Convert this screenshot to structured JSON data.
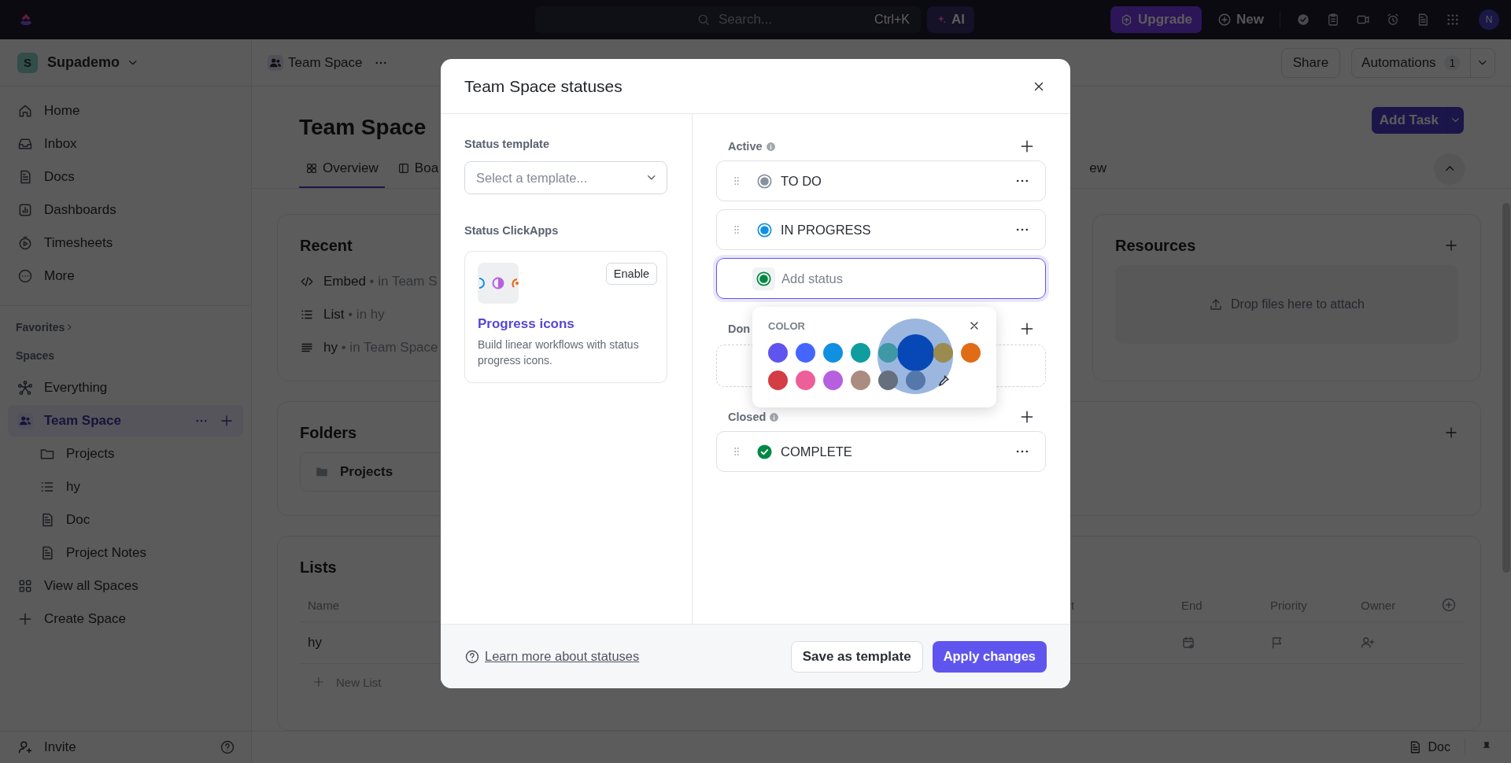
{
  "top_bar": {
    "search": {
      "placeholder": "Search...",
      "shortcut": "Ctrl+K"
    },
    "ai_button": "AI",
    "upgrade_button": "Upgrade",
    "new_button": "New",
    "avatar": "N"
  },
  "sidebar": {
    "workspace": {
      "initial": "S",
      "name": "Supademo"
    },
    "nav": [
      {
        "kind": "home",
        "label": "Home",
        "selected": false
      },
      {
        "kind": "inbox",
        "label": "Inbox",
        "selected": false
      },
      {
        "kind": "doc",
        "label": "Docs",
        "selected": false
      },
      {
        "kind": "dashboard",
        "label": "Dashboards",
        "selected": false
      },
      {
        "kind": "timesheet",
        "label": "Timesheets",
        "selected": false
      },
      {
        "kind": "more",
        "label": "More",
        "selected": false
      }
    ],
    "favorites": "Favorites",
    "spaces_heading": "Spaces",
    "spaces": [
      {
        "kind": "everything",
        "label": "Everything",
        "selected": false
      },
      {
        "kind": "team",
        "label": "Team Space",
        "selected": true,
        "children": [
          {
            "kind": "folder",
            "label": "Projects",
            "selected": false
          },
          {
            "kind": "list",
            "label": "hy",
            "selected": false
          },
          {
            "kind": "doc",
            "label": "Doc",
            "selected": false
          },
          {
            "kind": "doc",
            "label": "Project Notes",
            "selected": false
          }
        ]
      },
      {
        "kind": "grid",
        "label": "View all Spaces",
        "selected": false
      },
      {
        "kind": "plus",
        "label": "Create Space",
        "selected": false
      }
    ],
    "invite": "Invite"
  },
  "header": {
    "breadcrumb": "Team Space",
    "share_button": "Share",
    "automations_button": {
      "label": "Automations",
      "count": "1"
    }
  },
  "page": {
    "title": "Team Space",
    "add_task_button": "Add Task",
    "tabs": [
      {
        "kind": "overview",
        "label": "Overview",
        "selected": true
      },
      {
        "kind": "board",
        "label": "Boa",
        "selected": false
      },
      {
        "kind": "plain",
        "label": "ew",
        "selected": false
      }
    ]
  },
  "recent": {
    "title": "Recent",
    "items": [
      {
        "kind": "embed",
        "name": "Embed",
        "location": "• in Team S"
      },
      {
        "kind": "list",
        "name": "List",
        "location": "• in hy"
      },
      {
        "kind": "lines",
        "name": "hy",
        "location": "• in Team Space"
      }
    ]
  },
  "resources": {
    "title": "Resources",
    "drop_hint": "Drop files here to attach"
  },
  "folders": {
    "title": "Folders",
    "items": [
      {
        "name": "Projects"
      }
    ]
  },
  "lists": {
    "title": "Lists",
    "columns": [
      "Name",
      "t",
      "End",
      "Priority",
      "Owner"
    ],
    "rows": [
      {
        "name": "hy"
      }
    ],
    "new_list": "New List"
  },
  "bottom_bar": {
    "doc": "Doc"
  },
  "modal": {
    "title": "Team Space statuses",
    "template_label": "Status template",
    "template_select": {
      "placeholder": "Select a template..."
    },
    "clickapps_label": "Status ClickApps",
    "clickapp": {
      "title": "Progress icons",
      "description": "Build linear workflows with status progress icons.",
      "enable_button": "Enable"
    },
    "status_groups": [
      {
        "label": "Active",
        "info": true,
        "statuses": [
          {
            "kind": "open",
            "name": "TO DO",
            "color": "#87909e"
          },
          {
            "kind": "open",
            "name": "IN PROGRESS",
            "color": "#1090e0"
          },
          {
            "kind": "input",
            "placeholder": "Add status",
            "color": "#008844",
            "focused": true
          }
        ]
      },
      {
        "label": "Don"
      },
      {
        "label": "Closed",
        "info": true,
        "statuses": [
          {
            "kind": "closed",
            "name": "COMPLETE",
            "color": "#008844"
          }
        ]
      }
    ],
    "color_picker": {
      "label": "COLOR",
      "swatches": [
        {
          "color": "#5f55ee"
        },
        {
          "color": "#4466ff"
        },
        {
          "color": "#1090e0"
        },
        {
          "color": "#0f9d9f"
        },
        {
          "color": "#3f98a6"
        },
        {
          "color": "#9b8b4e"
        },
        {
          "color": "#e16b16"
        },
        {
          "color": "#d33d44"
        },
        {
          "color": "#ee5e99"
        },
        {
          "color": "#b660e0"
        },
        {
          "color": "#aa8d80"
        },
        {
          "color": "#656f7d"
        },
        {
          "color": "#5577a9"
        }
      ]
    },
    "help_link": "Learn more about statuses",
    "save_template_button": "Save as template",
    "apply_button": "Apply changes"
  }
}
